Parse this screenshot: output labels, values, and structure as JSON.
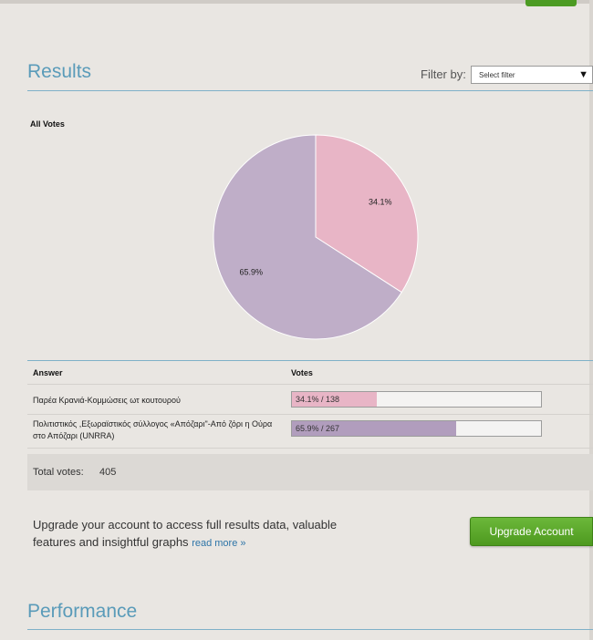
{
  "results": {
    "title": "Results",
    "filter_label": "Filter by:",
    "filter_value": "Select filter"
  },
  "chart_data": {
    "type": "pie",
    "title": "All Votes",
    "categories": [
      "Παρέα Κρανιά-Κομμώσεις ωτ κουτουρού",
      "Πολιτιστικός ,Εξωραϊστικός σύλλογος «Απόζαρι\"-Από ζόρι η Ούρα στο Απόζαρι (UNRRA)"
    ],
    "values": [
      34.1,
      65.9
    ],
    "labels": [
      "34.1%",
      "65.9%"
    ],
    "colors": [
      "#e8b5c6",
      "#bfaec8"
    ]
  },
  "table": {
    "headers": {
      "answer": "Answer",
      "votes": "Votes"
    },
    "rows": [
      {
        "answer": "Παρέα Κρανιά-Κομμώσεις ωτ κουτουρού",
        "vote_label": "34.1% / 138",
        "percent": 34.1,
        "color": "#e8b5c6"
      },
      {
        "answer": "Πολιτιστικός ,Εξωραϊστικός σύλλογος «Απόζαρι\"-Από ζόρι η Ούρα στο Απόζαρι (UNRRA)",
        "vote_label": "65.9% / 267",
        "percent": 65.9,
        "color": "#b19dbd"
      }
    ],
    "total_label": "Total votes:",
    "total_value": "405"
  },
  "upgrade": {
    "text": "Upgrade your account to access full results data, valuable features and insightful graphs",
    "read_more": "read more »",
    "button": "Upgrade Account"
  },
  "performance": {
    "title": "Performance"
  },
  "colors": {
    "accent": "#5a9bb9",
    "button_green": "#4e9a1f"
  }
}
